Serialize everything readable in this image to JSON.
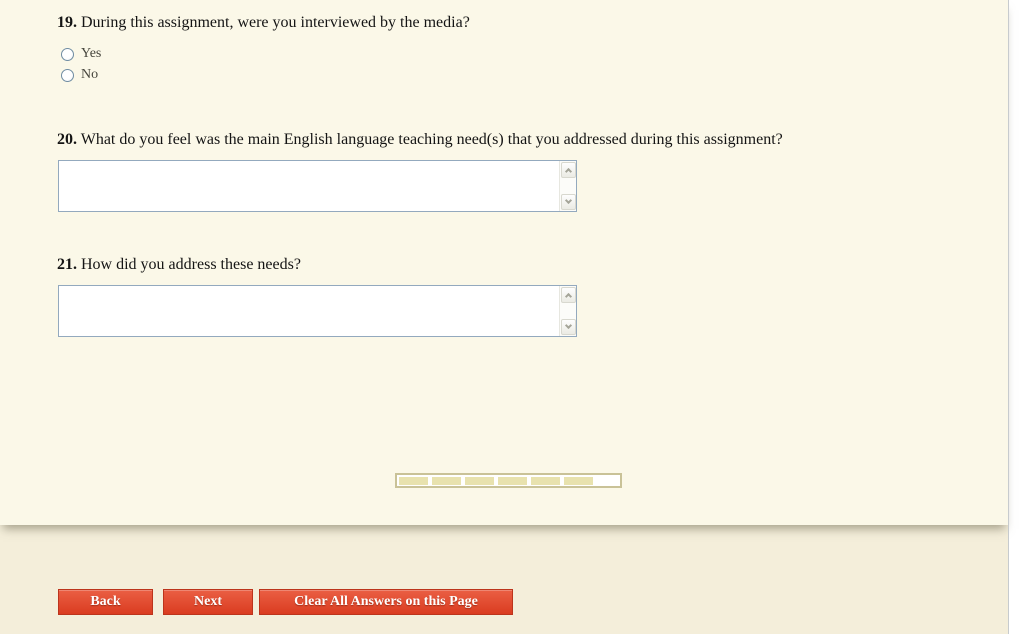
{
  "questions": [
    {
      "number": "19.",
      "text": "During this assignment, were you interviewed by the media?",
      "type": "radio",
      "options": [
        {
          "label": "Yes",
          "selected": false
        },
        {
          "label": "No",
          "selected": false
        }
      ]
    },
    {
      "number": "20.",
      "text": "What do you feel was the main English language teaching need(s) that you addressed during this assignment?",
      "type": "textarea",
      "value": ""
    },
    {
      "number": "21.",
      "text": "How did you address these needs?",
      "type": "textarea",
      "value": ""
    }
  ],
  "progress": {
    "filled_segments": 6,
    "fill_percent": 60
  },
  "footer": {
    "buttons": [
      {
        "label": "Back"
      },
      {
        "label": "Next"
      },
      {
        "label": "Clear All Answers on this Page"
      }
    ]
  },
  "colors": {
    "page_background": "#fbf8e8",
    "footer_background": "#f4eeda",
    "button_fill": "#df4126",
    "button_border": "#bc341c",
    "progress_fill": "#e8e2ae",
    "progress_border": "#c9c297",
    "textarea_border": "#93a9be",
    "radio_border": "#6f8ca2"
  }
}
